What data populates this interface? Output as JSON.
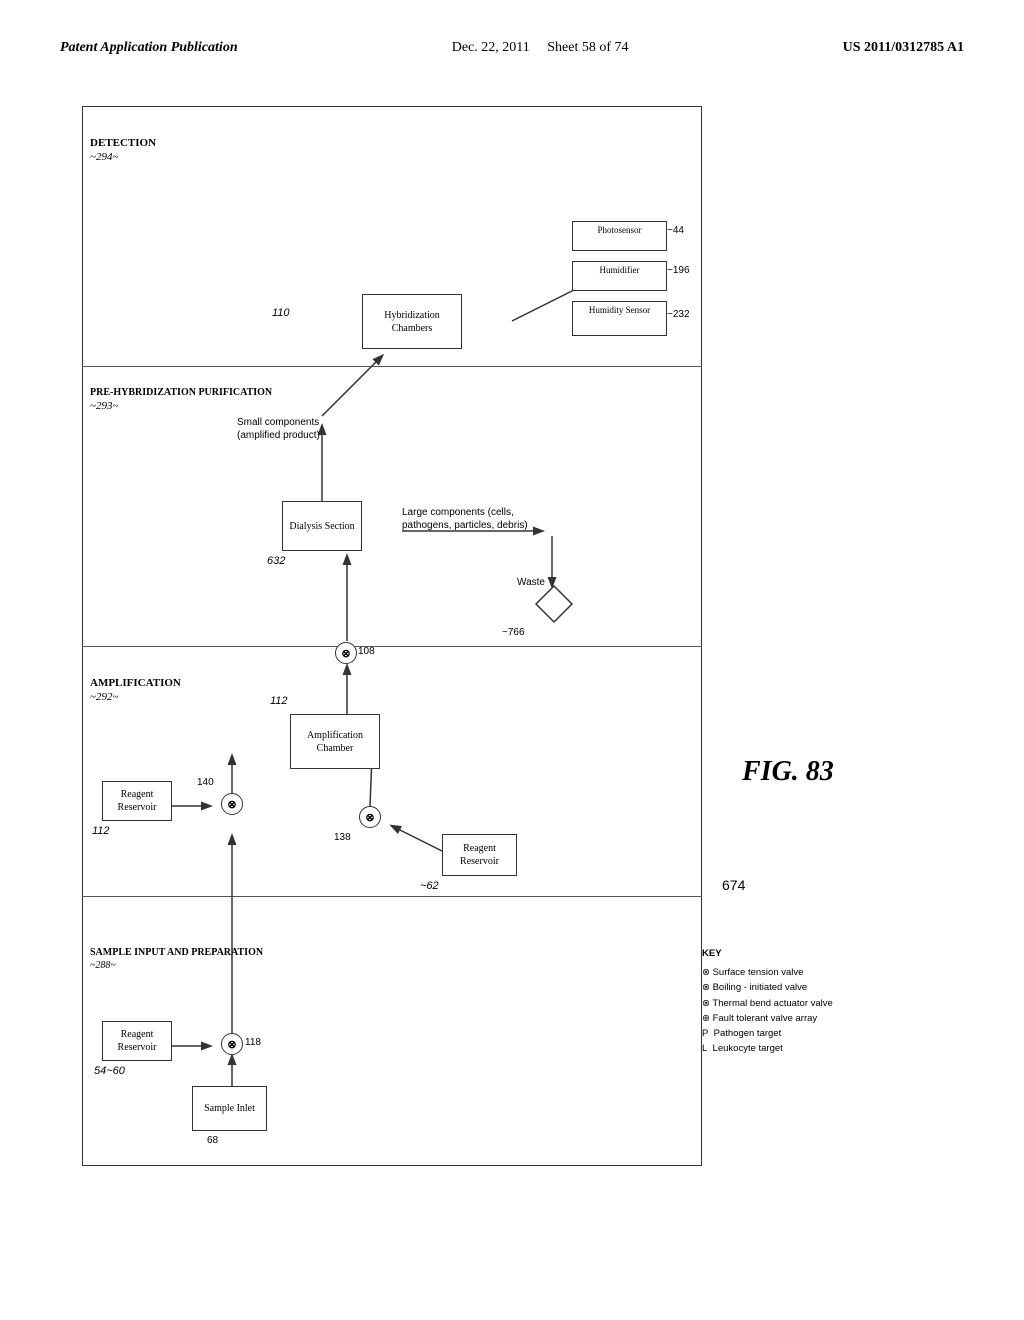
{
  "header": {
    "left": "Patent Application Publication",
    "center_date": "Dec. 22, 2011",
    "center_sheet": "Sheet 58 of 74",
    "right": "US 2011/0312785 A1"
  },
  "figure": {
    "label": "FIG. 83",
    "number": "83"
  },
  "sections": {
    "sample_input": {
      "label": "SAMPLE INPUT\nAND PREPARATION",
      "ref": "~288~"
    },
    "amplification": {
      "label": "AMPLIFICATION",
      "ref": "~292~"
    },
    "pre_hybridization": {
      "label": "PRE-HYBRIDIZATION\nPURIFICATION",
      "ref": "~293~"
    },
    "detection": {
      "label": "DETECTION",
      "ref": "~294~"
    }
  },
  "nodes": {
    "sample_inlet": {
      "label": "Sample\nInlet",
      "ref": "68"
    },
    "reagent_reservoir_54": {
      "label": "Reagent\nReservoir",
      "ref": "54~60"
    },
    "reagent_reservoir_112": {
      "label": "Reagent\nReservoir",
      "ref": "112"
    },
    "amplification_chamber": {
      "label": "Amplification\nChamber",
      "ref": ""
    },
    "reagent_reservoir_62": {
      "label": "Reagent\nReservoir",
      "ref": "~62"
    },
    "dialysis_section": {
      "label": "Dialysis\nSection",
      "ref": "632"
    },
    "hybridization_chambers": {
      "label": "Hybridization\nChambers",
      "ref": "110"
    },
    "photosensor": {
      "label": "Photosensor",
      "ref": "~44"
    },
    "humidifier": {
      "label": "Humidifier",
      "ref": "~196"
    },
    "humidity_sensor": {
      "label": "Humidity\nSensor",
      "ref": "~232"
    }
  },
  "valves": {
    "v118": "118",
    "v140": "140",
    "v138": "138",
    "v108": "108"
  },
  "labels": {
    "small_components": "Small\ncomponents\n(amplified\nproduct)",
    "large_components": "Large components\n(cells, pathogens,\nparticles, debris)",
    "waste": "Waste",
    "waste_ref": "~766",
    "ref_674": "674"
  },
  "key": {
    "title": "KEY",
    "items": [
      {
        "symbol": "⊗",
        "text": "Surface tension valve"
      },
      {
        "symbol": "⊗",
        "text": "Boiling - initiated valve"
      },
      {
        "symbol": "⊗",
        "text": "Thermal bend actuator valve"
      },
      {
        "symbol": "⊕",
        "text": "Fault tolerant valve array"
      },
      {
        "symbol": "P",
        "text": "Pathogen target"
      },
      {
        "symbol": "L",
        "text": "Leukocyte target"
      }
    ]
  }
}
